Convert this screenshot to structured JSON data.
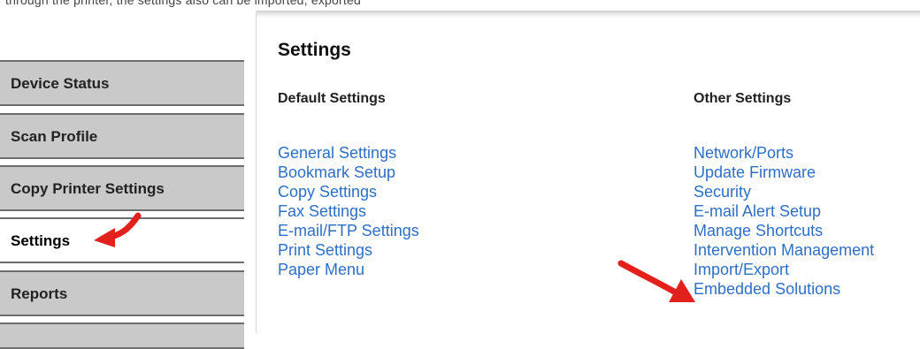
{
  "top_strip_text": "through the printer, the settings also can be imported, exported",
  "sidebar": {
    "items": [
      {
        "label": "Device Status",
        "active": false
      },
      {
        "label": "Scan Profile",
        "active": false
      },
      {
        "label": "Copy Printer Settings",
        "active": false
      },
      {
        "label": "Settings",
        "active": true
      },
      {
        "label": "Reports",
        "active": false
      },
      {
        "label": "",
        "active": false
      }
    ]
  },
  "main": {
    "title": "Settings",
    "default_settings": {
      "heading": "Default Settings",
      "links": [
        "General Settings",
        "Bookmark Setup",
        "Copy Settings",
        "Fax Settings",
        "E-mail/FTP Settings",
        "Print Settings",
        "Paper Menu"
      ]
    },
    "other_settings": {
      "heading": "Other Settings",
      "links": [
        "Network/Ports",
        "Update Firmware",
        "Security",
        "E-mail Alert Setup",
        "Manage Shortcuts",
        "Intervention Management",
        "Import/Export",
        "Embedded Solutions"
      ]
    }
  },
  "annotation_arrows": [
    {
      "color": "#e3211c",
      "points_to": "Settings"
    },
    {
      "color": "#e3211c",
      "points_to": "Import/Export"
    }
  ]
}
